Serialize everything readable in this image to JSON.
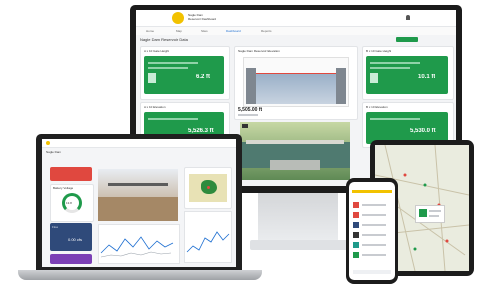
{
  "monitor": {
    "brand": {
      "line1": "Nagle Dam",
      "line2": "Reservoir Dashboard"
    },
    "page_title": "Nagle Dam Reservoir Data",
    "nav": [
      "Home",
      "Map",
      "Sites",
      "Dashboard",
      "Reports"
    ],
    "cards": [
      {
        "title": "A x 10 Gate Height",
        "value": "6.2 ft"
      },
      {
        "title": "Nagle Dam Reservoir Elevation",
        "value": "5,505.00 ft"
      },
      {
        "title": "B x 10 Gate Height",
        "value": "10.1 ft"
      }
    ],
    "bottom_cards": [
      {
        "title": "A x 10 Elevation",
        "value": "5,526.3 ft"
      },
      {
        "title": "B x 10 Elevation",
        "value": "5,530.0 ft"
      }
    ]
  },
  "laptop": {
    "page_title": "Nagle Dam",
    "widgets": [
      {
        "title": "Battery Voltage",
        "value": "13.8"
      },
      {
        "title": "Flow",
        "value": "0.00 cfs"
      }
    ]
  },
  "colors": {
    "green": "#1f9a4b",
    "red": "#e0483f",
    "purple": "#7b3fb5",
    "navy": "#2f4a7a",
    "teal": "#1e9a8a"
  },
  "icons": [
    "logo-icon",
    "bell-icon",
    "map-pin-icon",
    "gauge-icon",
    "camera-icon"
  ]
}
